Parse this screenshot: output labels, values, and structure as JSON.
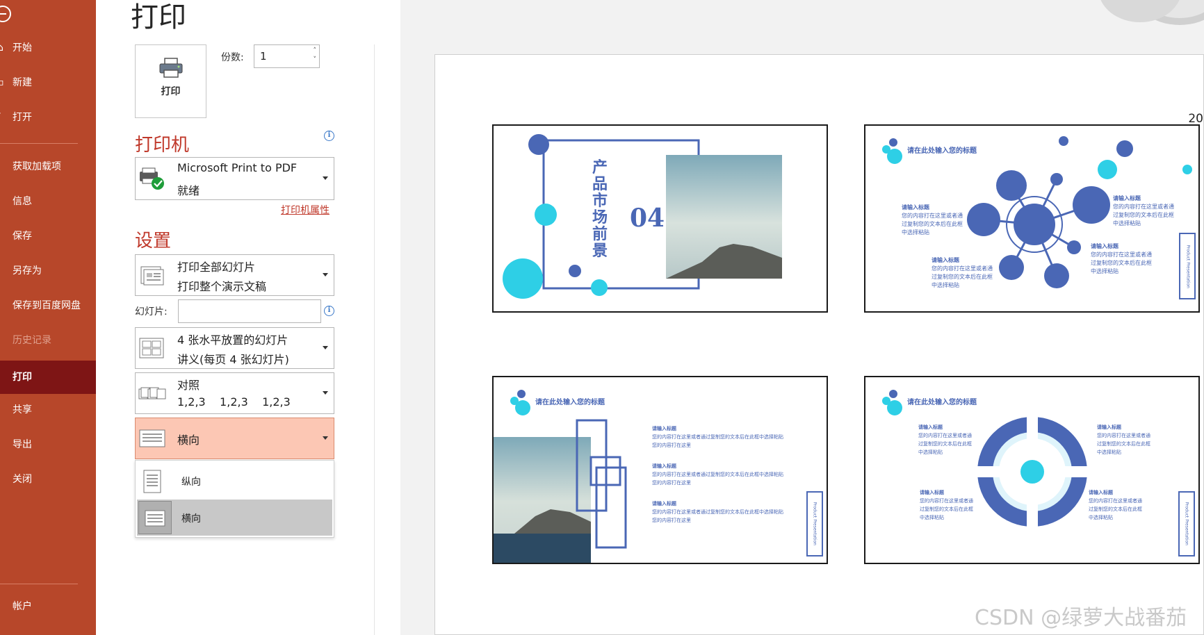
{
  "nav": {
    "items": [
      {
        "label": "开始"
      },
      {
        "label": "新建"
      },
      {
        "label": "打开"
      },
      {
        "label": "获取加载项"
      },
      {
        "label": "信息"
      },
      {
        "label": "保存"
      },
      {
        "label": "另存为"
      },
      {
        "label": "保存到百度网盘"
      },
      {
        "label": "历史记录"
      },
      {
        "label": "打印"
      },
      {
        "label": "共享"
      },
      {
        "label": "导出"
      },
      {
        "label": "关闭"
      },
      {
        "label": "帐户"
      }
    ]
  },
  "page": {
    "title": "打印"
  },
  "print": {
    "button_label": "打印",
    "copies_label": "份数:",
    "copies_value": "1"
  },
  "printer": {
    "heading": "打印机",
    "name": "Microsoft Print to PDF",
    "status": "就绪",
    "properties_link": "打印机属性"
  },
  "settings": {
    "heading": "设置",
    "range": {
      "line1": "打印全部幻灯片",
      "line2": "打印整个演示文稿"
    },
    "slides_label": "幻灯片:",
    "slides_value": "",
    "layout": {
      "line1": "4 张水平放置的幻灯片",
      "line2": "讲义(每页 4 张幻灯片)"
    },
    "collate": {
      "line1": "对照",
      "line2": "1,2,3    1,2,3    1,2,3"
    },
    "orientation": {
      "selected": "横向"
    },
    "orientation_options": [
      {
        "label": "纵向",
        "selected": false
      },
      {
        "label": "横向",
        "selected": true
      }
    ]
  },
  "preview": {
    "year": "20",
    "thumbs": {
      "t1": {
        "title": "产品市场前景",
        "number": "04"
      },
      "title_text": "请在此处输入您的标题",
      "sub_heading": "请输入标题",
      "body_line1": "您的内容打在这里或者通",
      "body_line2": "过复制您的文本后在此框",
      "body_line3": "中选择粘贴",
      "t3_body1": "您的内容打在这里或者通过复制您的文本后在此框中选择粘贴",
      "t3_body2": "您的内容打在这里",
      "side_tag": "Product Presentation"
    }
  },
  "watermark": "CSDN @绿萝大战番茄",
  "colors": {
    "accent": "#b7472a",
    "nav_active": "#7e1515",
    "orientation_highlight": "#fcc7b4",
    "slide_blue": "#4a67b5",
    "slide_cyan": "#2ecfe6"
  }
}
